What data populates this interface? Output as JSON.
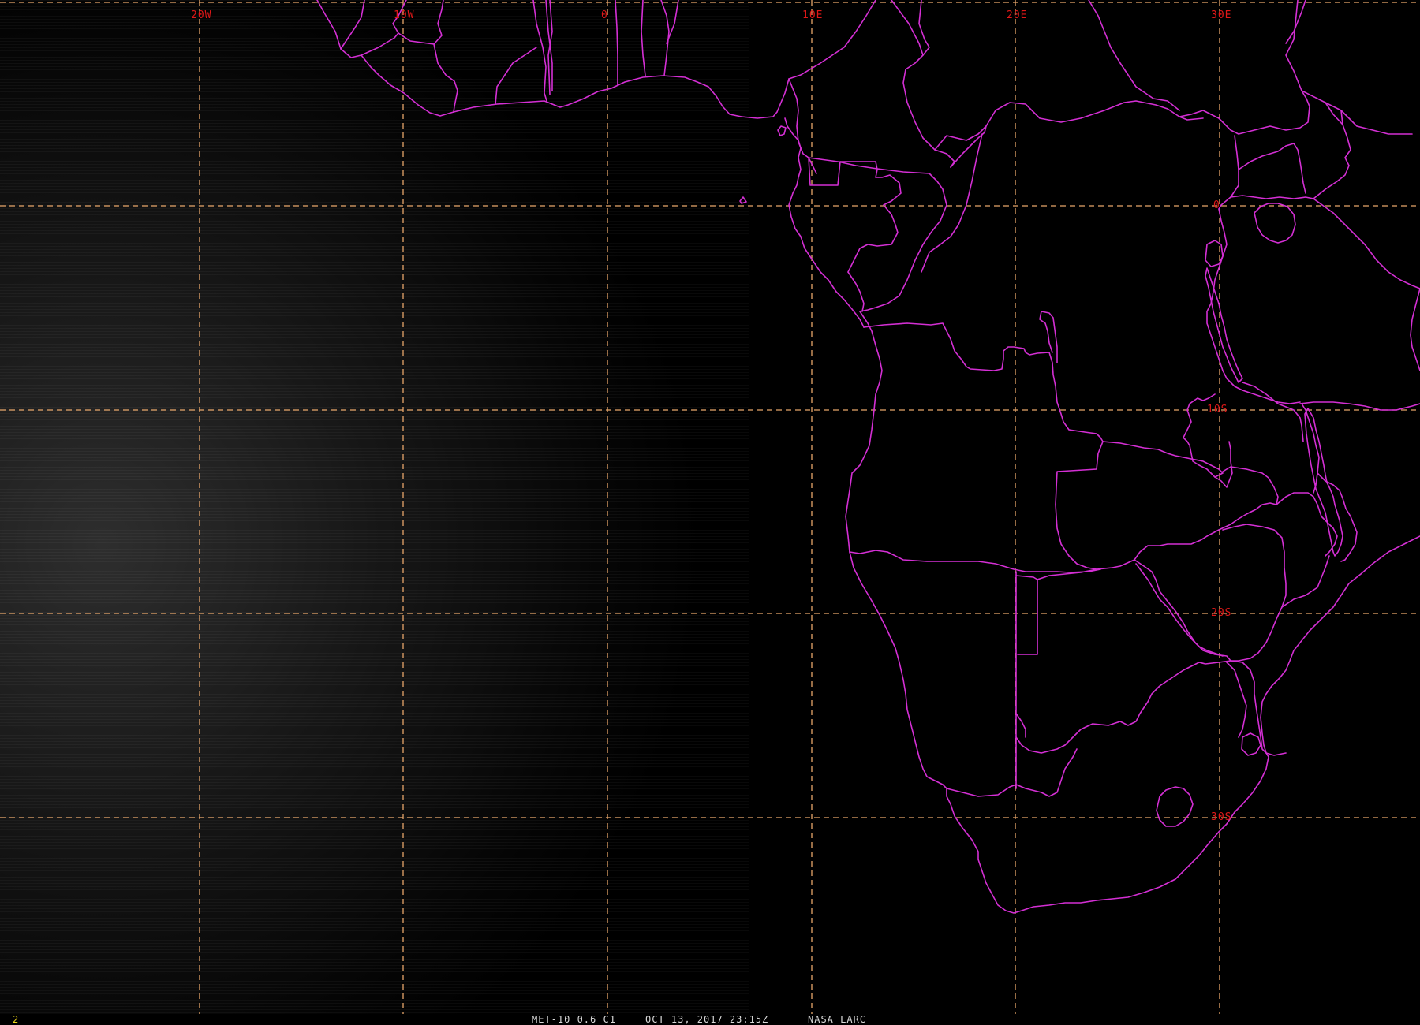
{
  "frame": {
    "number": "2"
  },
  "caption": {
    "satellite": "MET-10 0.6 C1",
    "datetime": "OCT 13, 2017 23:15Z",
    "agency": "NASA LARC"
  },
  "graticule": {
    "longitude_labels": [
      "20W",
      "10W",
      "0",
      "10E",
      "20E",
      "30E"
    ],
    "latitude_labels": [
      "0",
      "10S",
      "20S",
      "30S"
    ]
  },
  "colors": {
    "background": "#000000",
    "borders": "#d42fd4",
    "grid_lines": "#e8a66a",
    "grid_labels": "#e01818",
    "frame_number": "#e8d21a",
    "caption_text": "#d9d9d9"
  }
}
